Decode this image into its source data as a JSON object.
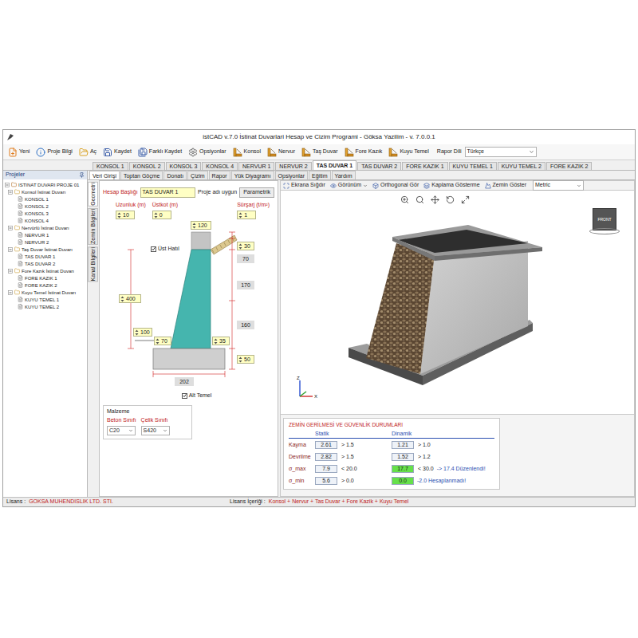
{
  "window": {
    "title": "istCAD v.7.0 İstinat Duvarlari Hesap ve Cizim Programi - Göksa Yazilim - v. 7.0.0.1"
  },
  "toolbar": [
    {
      "label": "Yeni"
    },
    {
      "label": "Proje Bilgi"
    },
    {
      "label": "Aç"
    },
    {
      "label": "Kaydet"
    },
    {
      "label": "Farklı Kaydet"
    },
    {
      "label": "Opsiyonlar"
    },
    {
      "label": "Konsol"
    },
    {
      "label": "Nervur"
    },
    {
      "label": "Taş Duvar"
    },
    {
      "label": "Fore Kazık"
    },
    {
      "label": "Kuyu Temel"
    }
  ],
  "report_language": {
    "label": "Rapor Dili",
    "value": "Türkçe"
  },
  "tabs": [
    {
      "label": "KONSOL 1",
      "selected": false
    },
    {
      "label": "KONSOL 2",
      "selected": false
    },
    {
      "label": "KONSOL 3",
      "selected": false
    },
    {
      "label": "KONSOL 4",
      "selected": false
    },
    {
      "label": "NERVUR 1",
      "selected": false
    },
    {
      "label": "NERVUR 2",
      "selected": false
    },
    {
      "label": "TAS DUVAR 1",
      "selected": true
    },
    {
      "label": "TAS DUVAR 2",
      "selected": false
    },
    {
      "label": "FORE KAZIK 1",
      "selected": false
    },
    {
      "label": "KUYU TEMEL 1",
      "selected": false
    },
    {
      "label": "KUYU TEMEL 2",
      "selected": false
    },
    {
      "label": "FORE KAZIK 2",
      "selected": false
    }
  ],
  "sidebar": {
    "title": "Projeler"
  },
  "tree": {
    "label": "ISTINAT DUVARI PROJE 01",
    "expanded": true,
    "groups": [
      {
        "label": "Konsol İstinat Duvarı",
        "expanded": true,
        "items": [
          "KONSOL 1",
          "KONSOL 2",
          "KONSOL 3",
          "KONSOL 4"
        ]
      },
      {
        "label": "Nervürlü İstinat Duvarı",
        "expanded": true,
        "items": [
          "NERVUR 1",
          "NERVUR 2"
        ]
      },
      {
        "label": "Taş Duvar İstinat Duvarı",
        "expanded": true,
        "items": [
          "TAS DUVAR 1",
          "TAS DUVAR 2"
        ]
      },
      {
        "label": "Fore Kazık İstinat Duvarı",
        "expanded": true,
        "items": [
          "FORE KAZIK 1",
          "FORE KAZIK 2"
        ]
      },
      {
        "label": "Kuyu Temel İstinat Duvarı",
        "expanded": true,
        "items": [
          "KUYU TEMEL 1",
          "KUYU TEMEL 2"
        ]
      }
    ]
  },
  "subtabs": [
    {
      "label": "Veri Girişi",
      "selected": true
    },
    {
      "label": "Toptan Göçme",
      "selected": false
    },
    {
      "label": "Donatı",
      "selected": false
    },
    {
      "label": "Çizim",
      "selected": false
    },
    {
      "label": "Rapor",
      "selected": false
    },
    {
      "label": "Yük Diyagramı",
      "selected": false
    },
    {
      "label": "Opsiyonlar",
      "selected": false
    },
    {
      "label": "Eğitim",
      "selected": false
    },
    {
      "label": "Yardım",
      "selected": false
    }
  ],
  "side_tabs": [
    {
      "label": "Geometri",
      "selected": true
    },
    {
      "label": "Zemin Bilgileri",
      "selected": false
    },
    {
      "label": "Kanal Bilgileri",
      "selected": false
    }
  ],
  "form": {
    "title_label": "Hesap Başlığı",
    "title_value": "TAS DUVAR 1",
    "status": "Proje adı uygun",
    "param_button": "Parametrik",
    "fields": [
      {
        "label": "Uzunluk (m)",
        "value": "10"
      },
      {
        "label": "Üstkot (m)",
        "value": "0"
      },
      {
        "label": "Sürşarj (t/m²)",
        "value": "1"
      }
    ],
    "dimensions": [
      {
        "value": "120",
        "kind": "input"
      },
      {
        "value": "30",
        "kind": "input"
      },
      {
        "value": "70",
        "kind": "label"
      },
      {
        "value": "170",
        "kind": "label"
      },
      {
        "value": "400",
        "kind": "input"
      },
      {
        "value": "160",
        "kind": "label"
      },
      {
        "value": "100",
        "kind": "input"
      },
      {
        "value": "70",
        "kind": "input"
      },
      {
        "value": "35",
        "kind": "input"
      },
      {
        "value": "50",
        "kind": "input"
      },
      {
        "value": "202",
        "kind": "label"
      }
    ],
    "checkboxes": [
      {
        "label": "Üst Hatıl",
        "checked": true
      },
      {
        "label": "Alt Temel",
        "checked": true
      }
    ],
    "material": {
      "title": "Malzeme",
      "fields": [
        {
          "label": "Beton Sınıfı",
          "value": "C20"
        },
        {
          "label": "Çelik Sınıfı",
          "value": "S420"
        }
      ]
    }
  },
  "viewer_toolbar": [
    {
      "label": "Ekrana Sığdır"
    },
    {
      "label": "Görünüm"
    },
    {
      "label": "Orthogonal Gör"
    },
    {
      "label": "Kaplama Gösterme"
    },
    {
      "label": "Zemin Göster"
    }
  ],
  "units": "Metric",
  "view_cube": "FRONT",
  "axes": [
    "Z",
    "X"
  ],
  "results": {
    "title": "ZEMİN GERİLMESİ VE GÜVENLİK DURUMLARI",
    "columns": [
      "Statik",
      "Dinamik"
    ],
    "rows": [
      {
        "label": "Kayma",
        "static": {
          "value": "2.61",
          "limit": "> 1.5",
          "highlight": false
        },
        "dynamic": {
          "value": "1.21",
          "limit": "> 1.0",
          "highlight": false
        }
      },
      {
        "label": "Devrilme",
        "static": {
          "value": "2.82",
          "limit": "> 1.5",
          "highlight": false
        },
        "dynamic": {
          "value": "1.52",
          "limit": "> 1.2",
          "highlight": false
        }
      },
      {
        "label": "σ_max",
        "static": {
          "value": "7.9",
          "limit": "< 20.0",
          "highlight": false
        },
        "dynamic": {
          "value": "17.7",
          "limit": "< 30.0",
          "note": "-> 17.4 Düzenlendi!",
          "highlight": true
        }
      },
      {
        "label": "σ_min",
        "static": {
          "value": "5.6",
          "limit": "> 0.0",
          "highlight": false
        },
        "dynamic": {
          "value": "0.0",
          "note": "-2.0 Hesaplanmadı!",
          "highlight": true
        }
      }
    ]
  },
  "status_bar": {
    "license_label": "Lisans :",
    "license": "GOKSA MUHENDISLIK LTD. STI.",
    "content_label": "Lisans İçeriği :",
    "content": "Konsol + Nervur + Tas Duvar + Fore Kazik + Kuyu Temel"
  }
}
